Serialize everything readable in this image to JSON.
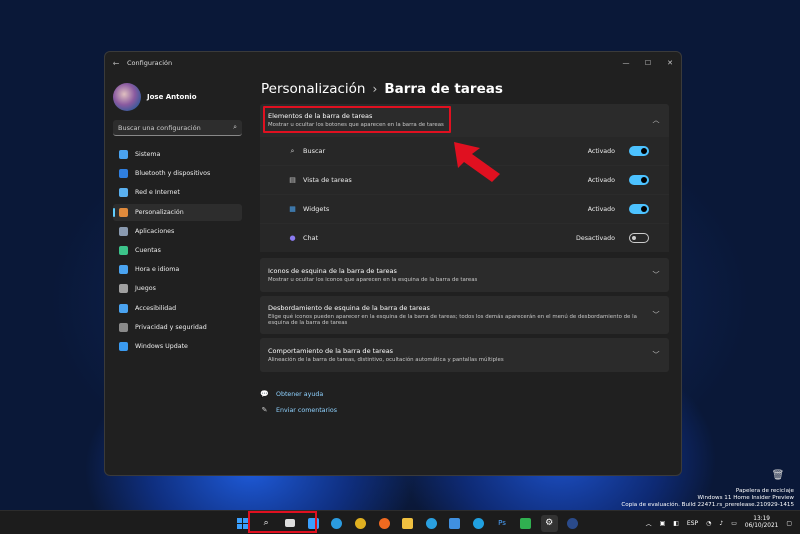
{
  "window": {
    "title": "Configuración"
  },
  "user": {
    "name": "Jose Antonio"
  },
  "search": {
    "placeholder": "Buscar una configuración"
  },
  "sidebar": {
    "items": [
      {
        "label": "Sistema",
        "icon": "monitor-icon",
        "color": "#4aa3f0"
      },
      {
        "label": "Bluetooth y dispositivos",
        "icon": "bluetooth-icon",
        "color": "#2f7fe0"
      },
      {
        "label": "Red e Internet",
        "icon": "wifi-icon",
        "color": "#5ab0f0"
      },
      {
        "label": "Personalización",
        "icon": "brush-icon",
        "color": "#e08a3c",
        "active": true
      },
      {
        "label": "Aplicaciones",
        "icon": "apps-icon",
        "color": "#8a9ab0"
      },
      {
        "label": "Cuentas",
        "icon": "person-icon",
        "color": "#3cc48a"
      },
      {
        "label": "Hora e idioma",
        "icon": "globe-clock-icon",
        "color": "#4aa3f0"
      },
      {
        "label": "Juegos",
        "icon": "gamepad-icon",
        "color": "#a0a0a0"
      },
      {
        "label": "Accesibilidad",
        "icon": "accessibility-icon",
        "color": "#4aa3f0"
      },
      {
        "label": "Privacidad y seguridad",
        "icon": "shield-icon",
        "color": "#8a8a8a"
      },
      {
        "label": "Windows Update",
        "icon": "update-icon",
        "color": "#3a9af0"
      }
    ]
  },
  "breadcrumb": {
    "parent": "Personalización",
    "separator": "›",
    "current": "Barra de tareas"
  },
  "taskbar_items": {
    "title": "Elementos de la barra de tareas",
    "desc": "Mostrar u ocultar los botones que aparecen en la barra de tareas",
    "rows": [
      {
        "label": "Buscar",
        "status": "Activado",
        "on": true
      },
      {
        "label": "Vista de tareas",
        "status": "Activado",
        "on": true
      },
      {
        "label": "Widgets",
        "status": "Activado",
        "on": true
      },
      {
        "label": "Chat",
        "status": "Desactivado",
        "on": false
      }
    ]
  },
  "sections": [
    {
      "title": "Iconos de esquina de la barra de tareas",
      "desc": "Mostrar u ocultar los iconos que aparecen en la esquina de la barra de tareas"
    },
    {
      "title": "Desbordamiento de esquina de la barra de tareas",
      "desc": "Elige qué iconos pueden aparecer en la esquina de la barra de tareas; todos los demás aparecerán en el menú de desbordamiento de la esquina de la barra de tareas"
    },
    {
      "title": "Comportamiento de la barra de tareas",
      "desc": "Alineación de la barra de tareas, distintivo, ocultación automática y pantallas múltiples"
    }
  ],
  "links": {
    "help": "Obtener ayuda",
    "feedback": "Enviar comentarios"
  },
  "desktop": {
    "recycle_bin": "Papelera de reciclaje",
    "watermark_line1": "Windows 11 Home Insider Preview",
    "watermark_line2": "Copia de evaluación. Build 22471.rs_prerelease.210929-1415"
  },
  "tray": {
    "lang": "ESP",
    "time": "13:19",
    "date": "06/10/2021"
  },
  "colors": {
    "accent": "#4cc2ff",
    "highlight": "#e01020"
  }
}
